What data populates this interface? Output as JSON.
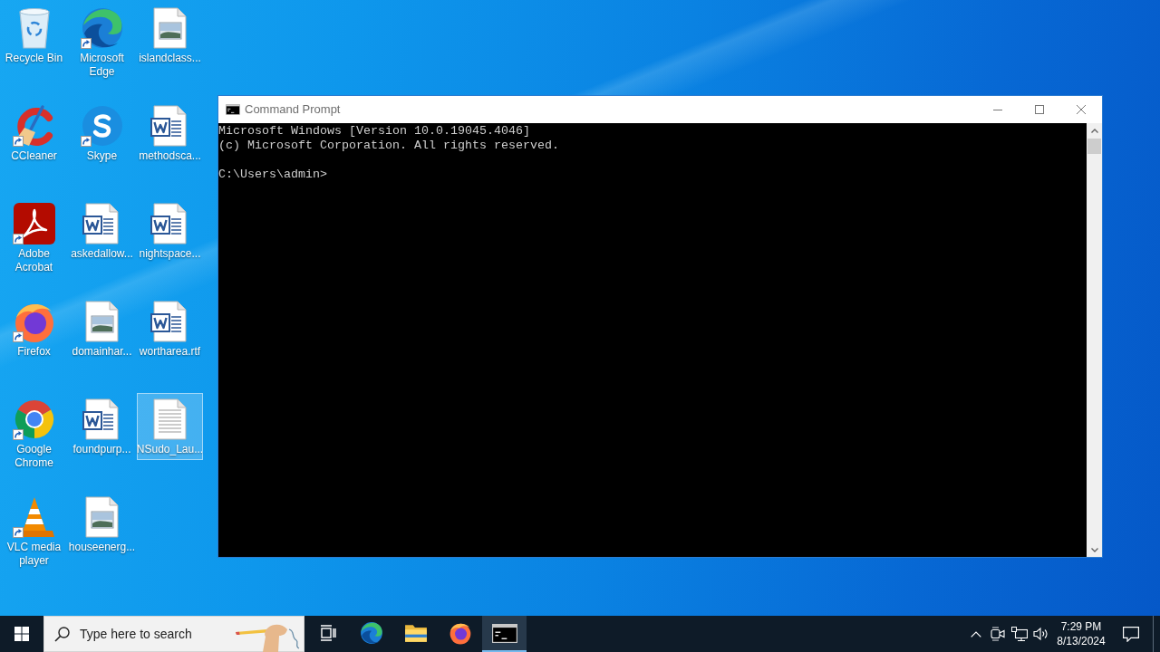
{
  "desktop_icons": [
    {
      "label": "Recycle Bin",
      "kind": "recycle-bin",
      "shortcut": false,
      "selected": false
    },
    {
      "label": "CCleaner",
      "kind": "ccleaner",
      "shortcut": true,
      "selected": false
    },
    {
      "label": "Adobe Acrobat",
      "kind": "acrobat",
      "shortcut": true,
      "selected": false
    },
    {
      "label": "Firefox",
      "kind": "firefox",
      "shortcut": true,
      "selected": false
    },
    {
      "label": "Google Chrome",
      "kind": "chrome",
      "shortcut": true,
      "selected": false
    },
    {
      "label": "VLC media player",
      "kind": "vlc",
      "shortcut": true,
      "selected": false
    },
    {
      "label": "Microsoft Edge",
      "kind": "edge",
      "shortcut": true,
      "selected": false
    },
    {
      "label": "Skype",
      "kind": "skype",
      "shortcut": true,
      "selected": false
    },
    {
      "label": "askedallow...",
      "kind": "word",
      "shortcut": false,
      "selected": false
    },
    {
      "label": "domainhar...",
      "kind": "image",
      "shortcut": false,
      "selected": false
    },
    {
      "label": "foundpurp...",
      "kind": "word",
      "shortcut": false,
      "selected": false
    },
    {
      "label": "houseenerg...",
      "kind": "image",
      "shortcut": false,
      "selected": false
    },
    {
      "label": "islandclass...",
      "kind": "image",
      "shortcut": false,
      "selected": false
    },
    {
      "label": "methodsca...",
      "kind": "word",
      "shortcut": false,
      "selected": false
    },
    {
      "label": "nightspace...",
      "kind": "word",
      "shortcut": false,
      "selected": false
    },
    {
      "label": "wortharea.rtf",
      "kind": "word",
      "shortcut": false,
      "selected": false
    },
    {
      "label": "NSudo_Lau...",
      "kind": "text",
      "shortcut": false,
      "selected": true
    }
  ],
  "window": {
    "title": "Command Prompt",
    "output": [
      "Microsoft Windows [Version 10.0.19045.4046]",
      "(c) Microsoft Corporation. All rights reserved."
    ],
    "prompt": "C:\\Users\\admin>"
  },
  "taskbar": {
    "search": {
      "placeholder": "Type here to search"
    },
    "apps": [
      {
        "kind": "edge",
        "selected": false
      },
      {
        "kind": "explorer",
        "selected": false
      },
      {
        "kind": "firefox",
        "selected": false
      },
      {
        "kind": "cmd",
        "selected": true
      }
    ],
    "clock": {
      "time": "7:29 PM",
      "date": "8/13/2024"
    }
  }
}
